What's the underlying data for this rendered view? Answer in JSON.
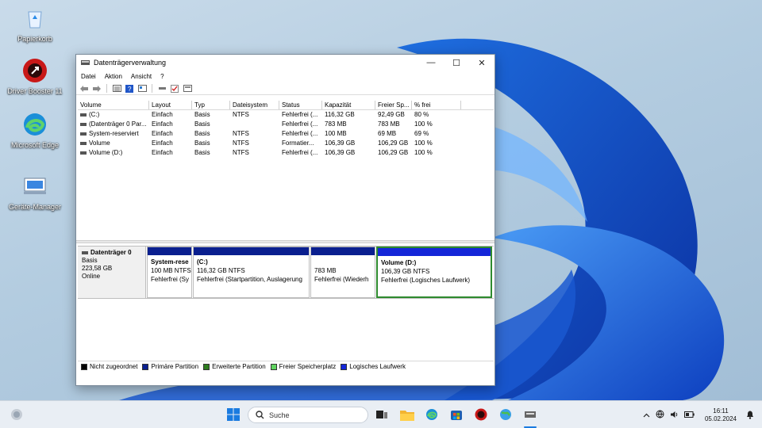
{
  "desktop": {
    "icons": [
      {
        "label": "Papierkorb"
      },
      {
        "label": "Driver Booster 11"
      },
      {
        "label": "Microsoft Edge"
      },
      {
        "label": "Geräte-Manager"
      }
    ]
  },
  "window": {
    "title": "Datenträgerverwaltung",
    "controls": {
      "minimize": "—",
      "maximize": "☐",
      "close": "✕"
    },
    "menu": [
      "Datei",
      "Aktion",
      "Ansicht",
      "?"
    ],
    "table": {
      "columns": [
        "Volume",
        "Layout",
        "Typ",
        "Dateisystem",
        "Status",
        "Kapazität",
        "Freier Sp...",
        "% frei"
      ],
      "rows": [
        [
          "(C:)",
          "Einfach",
          "Basis",
          "NTFS",
          "Fehlerfrei (...",
          "116,32 GB",
          "92,49 GB",
          "80 %"
        ],
        [
          "(Datenträger 0 Par...",
          "Einfach",
          "Basis",
          "",
          "Fehlerfrei (...",
          "783 MB",
          "783 MB",
          "100 %"
        ],
        [
          "System-reserviert",
          "Einfach",
          "Basis",
          "NTFS",
          "Fehlerfrei (...",
          "100 MB",
          "69 MB",
          "69 %"
        ],
        [
          "Volume",
          "Einfach",
          "Basis",
          "NTFS",
          "Formatier...",
          "106,39 GB",
          "106,29 GB",
          "100 %"
        ],
        [
          "Volume (D:)",
          "Einfach",
          "Basis",
          "NTFS",
          "Fehlerfrei (...",
          "106,39 GB",
          "106,29 GB",
          "100 %"
        ]
      ]
    },
    "disk": {
      "name": "Datenträger 0",
      "type": "Basis",
      "size": "223,58 GB",
      "status": "Online",
      "partitions": [
        {
          "title": "System-rese",
          "line1": "100 MB NTFS",
          "line2": "Fehlerfrei (Sy"
        },
        {
          "title": "(C:)",
          "line1": "116,32 GB NTFS",
          "line2": "Fehlerfrei (Startpartition, Auslagerung"
        },
        {
          "title": "",
          "line1": "783 MB",
          "line2": "Fehlerfrei (Wiederh"
        },
        {
          "title": "Volume  (D:)",
          "line1": "106,39 GB NTFS",
          "line2": "Fehlerfrei (Logisches Laufwerk)"
        }
      ]
    },
    "legend": [
      {
        "label": "Nicht zugeordnet",
        "color": "#000000"
      },
      {
        "label": "Primäre Partition",
        "color": "#0a1f8f"
      },
      {
        "label": "Erweiterte Partition",
        "color": "#2e7d1f"
      },
      {
        "label": "Freier Speicherplatz",
        "color": "#5fd35f"
      },
      {
        "label": "Logisches Laufwerk",
        "color": "#1426d8"
      }
    ]
  },
  "taskbar": {
    "search_placeholder": "Suche",
    "clock": {
      "time": "16:11",
      "date": "05.02.2024"
    }
  }
}
